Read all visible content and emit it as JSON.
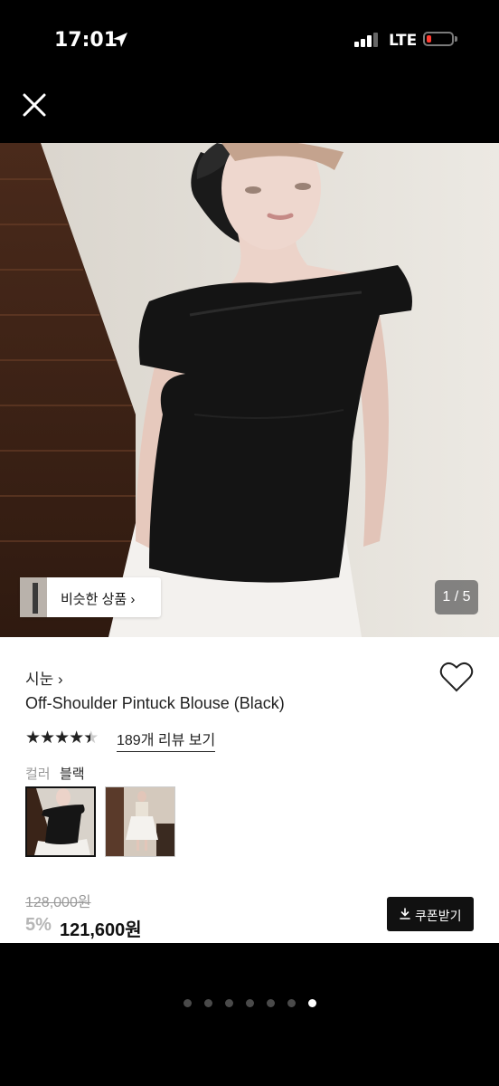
{
  "status_bar": {
    "time": "17:01",
    "network": "LTE"
  },
  "gallery": {
    "similar_label": "비슷한 상품",
    "counter": "1 / 5"
  },
  "product": {
    "brand": "시눈",
    "name": "Off-Shoulder Pintuck Blouse (Black)",
    "rating": 4.5,
    "reviews_label": "189개 리뷰 보기",
    "color_label": "컬러",
    "color_value": "블랙",
    "original_price": "128,000원",
    "discount": "5%",
    "price": "121,600원",
    "coupon_label": "쿠폰받기"
  },
  "page_indicator": {
    "total": 7,
    "active": 7
  },
  "colors": {
    "accent": "#111111",
    "battery_low": "#ff3b30"
  }
}
